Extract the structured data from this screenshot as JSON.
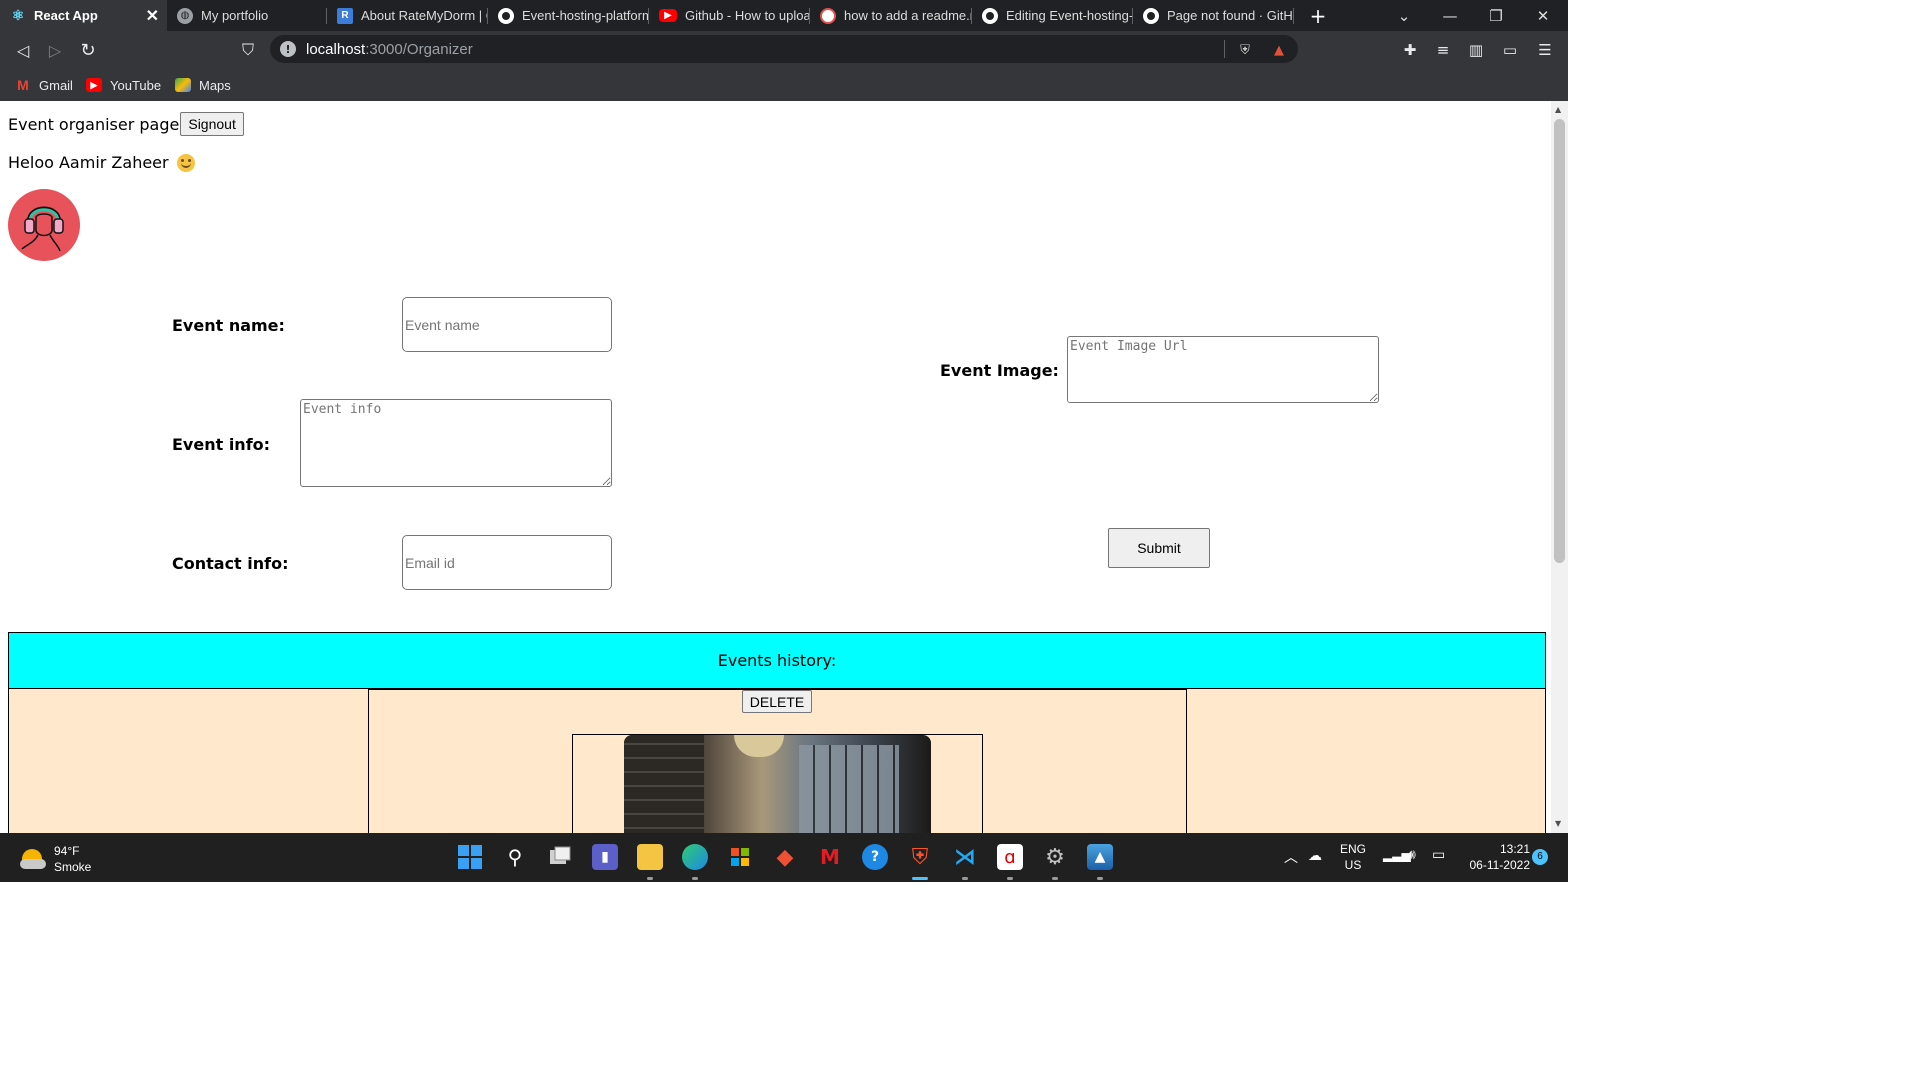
{
  "tabs": [
    {
      "title": "React App",
      "active": true
    },
    {
      "title": "My portfolio"
    },
    {
      "title": "About RateMyDorm | C"
    },
    {
      "title": "Event-hosting-platform"
    },
    {
      "title": "Github - How to uploa"
    },
    {
      "title": "how to add a readme.r"
    },
    {
      "title": "Editing Event-hosting-p"
    },
    {
      "title": "Page not found · GitHu"
    }
  ],
  "address_bar": {
    "host": "localhost",
    "path": ":3000/Organizer"
  },
  "bookmarks": [
    {
      "label": "Gmail"
    },
    {
      "label": "YouTube"
    },
    {
      "label": "Maps"
    }
  ],
  "page": {
    "heading": "Event organiser page",
    "signout_label": "Signout",
    "greeting": "Heloo Aamir Zaheer",
    "form": {
      "event_name_label": "Event name:",
      "event_name_placeholder": "Event name",
      "event_info_label": "Event info:",
      "event_info_placeholder": "Event info",
      "contact_label": "Contact info:",
      "contact_placeholder": "Email id",
      "event_image_label": "Event Image:",
      "event_image_placeholder": "Event Image Url",
      "submit_label": "Submit"
    },
    "history": {
      "title": "Events history:",
      "delete_label": "DELETE"
    }
  },
  "taskbar": {
    "weather": {
      "temp": "94°F",
      "condition": "Smoke"
    },
    "language": {
      "lang": "ENG",
      "region": "US"
    },
    "clock": {
      "time": "13:21",
      "date": "06-11-2022"
    },
    "notifications": "6"
  },
  "colors": {
    "history_header_bg": "#00ffff",
    "history_body_bg": "#ffe8cc",
    "avatar_bg": "#e8525a"
  }
}
